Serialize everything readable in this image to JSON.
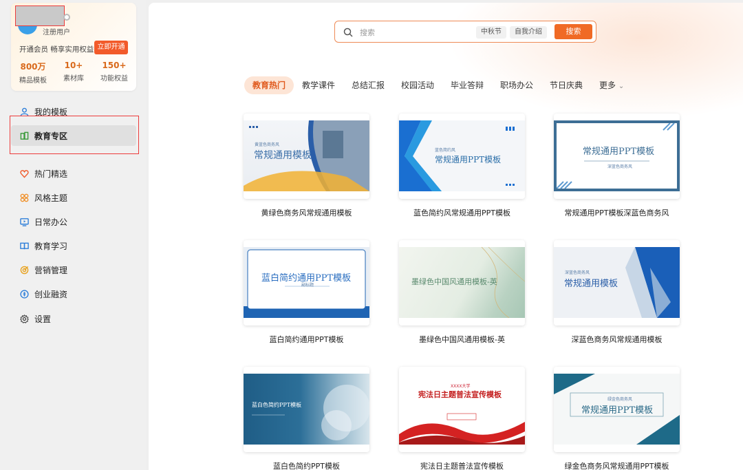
{
  "user": {
    "type_label": "注册用户",
    "vip_text": "开通会员 畅享实用权益",
    "vip_button": "立即开通",
    "stats": [
      {
        "num": "800万",
        "label": "精品模板"
      },
      {
        "num": "10+",
        "label": "素材库"
      },
      {
        "num": "150+",
        "label": "功能权益"
      }
    ]
  },
  "sidebar": {
    "items": [
      {
        "label": "我的模板",
        "icon": "user-icon"
      },
      {
        "label": "教育专区",
        "icon": "book-icon"
      },
      {
        "label": "热门精选",
        "icon": "heart-icon"
      },
      {
        "label": "风格主题",
        "icon": "clover-icon"
      },
      {
        "label": "日常办公",
        "icon": "monitor-icon"
      },
      {
        "label": "教育学习",
        "icon": "open-book-icon"
      },
      {
        "label": "营销管理",
        "icon": "target-icon"
      },
      {
        "label": "创业融资",
        "icon": "coin-icon"
      },
      {
        "label": "设置",
        "icon": "gear-icon"
      }
    ]
  },
  "search": {
    "placeholder": "搜索",
    "tags": [
      "中秋节",
      "自我介绍"
    ],
    "button": "搜索"
  },
  "tabs": [
    "教育热门",
    "教学课件",
    "总结汇报",
    "校园活动",
    "毕业答辩",
    "职场办公",
    "节日庆典",
    "更多"
  ],
  "templates": [
    {
      "caption": "黄绿色商务风常规通用模板",
      "title": "常规通用模板",
      "subtitle": "黄蓝色商务风"
    },
    {
      "caption": "蓝色简约风常规通用PPT模板",
      "title": "常规通用PPT模板",
      "subtitle": "蓝色简约风"
    },
    {
      "caption": "常规通用PPT模板深蓝色商务风",
      "title": "常规通用PPT模板",
      "subtitle": "深蓝色商务风"
    },
    {
      "caption": "蓝白简约通用PPT模板",
      "title": "蓝白简约通用PPT模板",
      "subtitle": "副标题"
    },
    {
      "caption": "墨绿色中国风通用模板-英",
      "title": "墨绿色中国风通用模板-英",
      "subtitle": ""
    },
    {
      "caption": "深蓝色商务风常规通用模板",
      "title": "常规通用模板",
      "subtitle": "深蓝色商务风"
    },
    {
      "caption": "蓝白色简约PPT模板",
      "title": "蓝白色简约PPT模板",
      "subtitle": ""
    },
    {
      "caption": "宪法日主题普法宣传模板",
      "title": "宪法日主题普法宣传模板",
      "subtitle": "XXXX大学"
    },
    {
      "caption": "绿金色商务风常规通用PPT模板",
      "title": "常规通用PPT模板",
      "subtitle": "绿金色商务风"
    }
  ],
  "colors": {
    "accent": "#f06a25",
    "highlight": "#ec3a3a"
  }
}
